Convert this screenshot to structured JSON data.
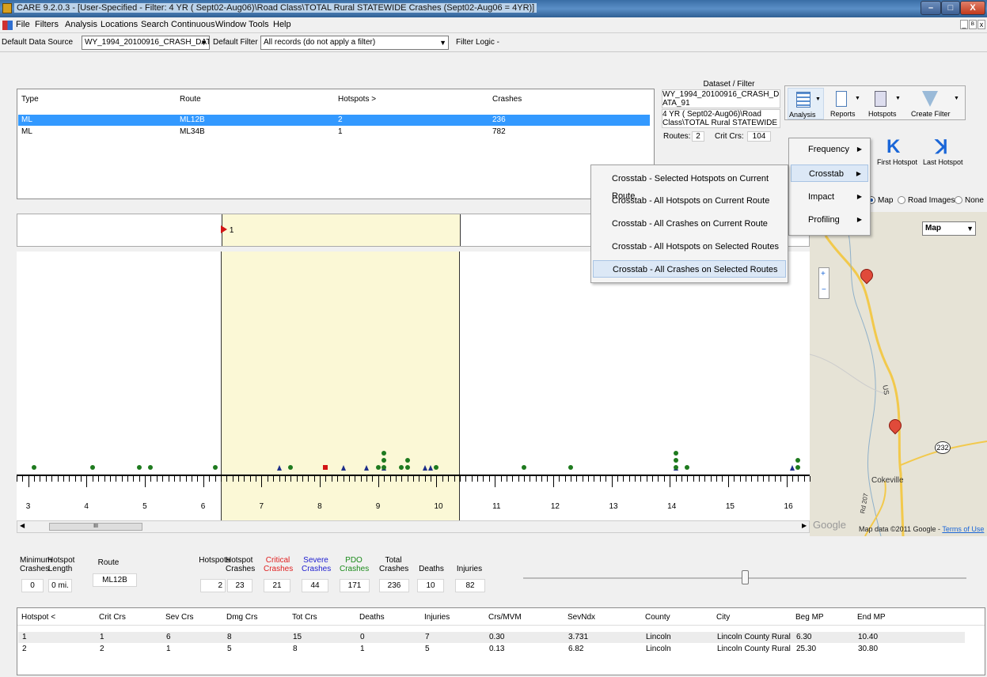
{
  "window": {
    "title": "CARE 9.2.0.3 - [User-Specified - Filter: 4 YR ( Sept02-Aug06)\\Road Class\\TOTAL Rural STATEWIDE Crashes (Sept02-Aug06 = 4YR)]"
  },
  "menu": [
    "File",
    "Filters",
    "Analysis",
    "Locations",
    "Search",
    "Continuous",
    "Window",
    "Tools",
    "Help"
  ],
  "toolbar": {
    "data_source_label": "Default Data Source",
    "data_source_value": "WY_1994_20100916_CRASH_DATA_9",
    "filter_label": "Default Filter",
    "filter_value": "All records (do not apply a filter)",
    "filter_logic": "Filter Logic -"
  },
  "routes_table": {
    "headers": [
      "Type",
      "Route",
      "Hotspots  >",
      "Crashes"
    ],
    "rows": [
      [
        "ML",
        "ML12B",
        "2",
        "236"
      ],
      [
        "ML",
        "ML34B",
        "1",
        "782"
      ]
    ]
  },
  "dataset": {
    "heading": "Dataset / Filter",
    "line1": "WY_1994_20100916_CRASH_DATA_91",
    "line2": "4 YR ( Sept02-Aug06)\\Road Class\\TOTAL Rural STATEWIDE Cras",
    "routes_label": "Routes:",
    "routes_value": "2",
    "crit_label": "Crit Crs:",
    "crit_value": "104"
  },
  "ribbon": {
    "analysis": "Analysis",
    "reports": "Reports",
    "hotspots": "Hotspots",
    "create_filter": "Create Filter",
    "first_hotspot": "First Hotspot",
    "last_hotspot": "Last Hotspot"
  },
  "view_options": {
    "map": "Map",
    "road_images": "Road Images",
    "none": "None",
    "map_type": "Map"
  },
  "analysis_menu": [
    {
      "label": "Frequency"
    },
    {
      "label": "Crosstab"
    },
    {
      "label": "Impact"
    },
    {
      "label": "Profiling"
    }
  ],
  "crosstab_menu": [
    "Crosstab - Selected Hotspots on Current Route",
    "Crosstab - All Hotspots on Current Route",
    "Crosstab - All Crashes on Current Route",
    "Crosstab - All Hotspots on Selected Routes",
    "Crosstab - All Crashes on Selected Routes"
  ],
  "strip": {
    "hotspot_marker": "1",
    "scale_labels": [
      "3",
      "4",
      "5",
      "6",
      "7",
      "8",
      "9",
      "10",
      "11",
      "12",
      "13",
      "14",
      "15",
      "16"
    ],
    "scroll_thumb": "III",
    "mile_start": 2.8,
    "mile_end": 16.4,
    "highlight_start": 6.3,
    "highlight_end": 10.4,
    "crashes": [
      {
        "mp": 3.1,
        "type": "dot",
        "stack": 1
      },
      {
        "mp": 4.1,
        "type": "dot",
        "stack": 1
      },
      {
        "mp": 4.9,
        "type": "dot",
        "stack": 1
      },
      {
        "mp": 5.1,
        "type": "dot",
        "stack": 1
      },
      {
        "mp": 6.2,
        "type": "dot",
        "stack": 1
      },
      {
        "mp": 7.3,
        "type": "tri",
        "stack": 1
      },
      {
        "mp": 7.5,
        "type": "dot",
        "stack": 1
      },
      {
        "mp": 8.1,
        "type": "sq",
        "stack": 1
      },
      {
        "mp": 8.4,
        "type": "tri",
        "stack": 1
      },
      {
        "mp": 8.8,
        "type": "tri",
        "stack": 1
      },
      {
        "mp": 9.0,
        "type": "dot",
        "stack": 1
      },
      {
        "mp": 9.1,
        "type": "tri",
        "stack": 1
      },
      {
        "mp": 9.1,
        "type": "dot",
        "stack": 3
      },
      {
        "mp": 9.4,
        "type": "dot",
        "stack": 1
      },
      {
        "mp": 9.5,
        "type": "dot",
        "stack": 2
      },
      {
        "mp": 9.8,
        "type": "tri",
        "stack": 1
      },
      {
        "mp": 9.9,
        "type": "tri",
        "stack": 1
      },
      {
        "mp": 10.0,
        "type": "dot",
        "stack": 1
      },
      {
        "mp": 11.5,
        "type": "dot",
        "stack": 1
      },
      {
        "mp": 12.3,
        "type": "dot",
        "stack": 1
      },
      {
        "mp": 14.1,
        "type": "tri",
        "stack": 1
      },
      {
        "mp": 14.1,
        "type": "dot",
        "stack": 3
      },
      {
        "mp": 14.3,
        "type": "dot",
        "stack": 1
      },
      {
        "mp": 16.1,
        "type": "tri",
        "stack": 1
      },
      {
        "mp": 16.2,
        "type": "dot",
        "stack": 2
      }
    ]
  },
  "map": {
    "town": "Cokeville",
    "road": "232",
    "county_road": "Rd 207",
    "us_label": "US",
    "attribution": "Map data ©2011 Google - ",
    "terms": "Terms of Use",
    "brand": "Google"
  },
  "summary": {
    "min_crashes_label": "Minimum Crashes",
    "min_crashes": "0",
    "hotspot_length_label": "Hotspot Length",
    "hotspot_length": "0 mi.",
    "route_label": "Route",
    "route": "ML12B",
    "hotspots_label": "Hotspots",
    "hotspots": "2",
    "hotspot_crashes_label": "Hotspot Crashes",
    "hotspot_crashes": "23",
    "critical_label": "Critical Crashes",
    "critical": "21",
    "severe_label": "Severe Crashes",
    "severe": "44",
    "pdo_label": "PDO Crashes",
    "pdo": "171",
    "total_label": "Total Crashes",
    "total": "236",
    "deaths_label": "Deaths",
    "deaths": "10",
    "injuries_label": "Injuries",
    "injuries": "82",
    "slider_value": 0.5,
    "colors": {
      "critical": "#e02020",
      "severe": "#2020d0",
      "pdo": "#1a8a1a"
    }
  },
  "hotspot_table": {
    "headers": [
      "Hotspot  <",
      "Crit Crs",
      "Sev Crs",
      "Dmg Crs",
      "Tot Crs",
      "Deaths",
      "Injuries",
      "Crs/MVM",
      "SevNdx",
      "County",
      "City",
      "Beg MP",
      "End MP"
    ],
    "rows": [
      [
        "1",
        "1",
        "6",
        "8",
        "15",
        "0",
        "7",
        "0.30",
        "3.731",
        "Lincoln",
        "Lincoln County Rural",
        "6.30",
        "10.40"
      ],
      [
        "2",
        "2",
        "1",
        "5",
        "8",
        "1",
        "5",
        "0.13",
        "6.82",
        "Lincoln",
        "Lincoln County Rural",
        "25.30",
        "30.80"
      ]
    ]
  }
}
